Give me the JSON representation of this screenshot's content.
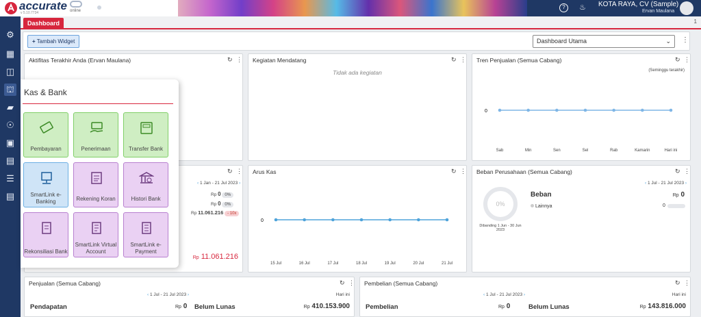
{
  "app": {
    "logo_text": "accurate",
    "logo_sub": "online",
    "version": "v 5.10.7734",
    "company": "KOTA RAYA, CV (Sample)",
    "user": "Ervan Maulana",
    "tab": "Dashboard",
    "tab_count": "1"
  },
  "toolbar": {
    "add_widget": "Tambah Widget",
    "dashboard_select": "Dashboard Utama"
  },
  "panels": {
    "activity": {
      "title": "Aktifitas Terakhir Anda (Ervan Maulana)"
    },
    "upcoming": {
      "title": "Kegiatan Mendatang",
      "empty": "Tidak ada kegiatan"
    },
    "sales_trend": {
      "title": "Tren Penjualan (Semua Cabang)",
      "period": "(Seminggu terakhir)",
      "zero": "0",
      "days": [
        "Sab",
        "Min",
        "Sen",
        "Sel",
        "Rab",
        "Kamarin",
        "Hari ini"
      ]
    },
    "bank": {
      "range": "1 Jan - 21 Jul 2023",
      "v1": "0",
      "v2": "0",
      "v3": "11.061.216",
      "p1": "0%",
      "p2": "0%",
      "p3": "- 10x",
      "total": "11.061.216",
      "rp": "Rp"
    },
    "cashflow": {
      "title": "Arus Kas",
      "zero": "0",
      "days": [
        "15 Jul",
        "16 Jul",
        "17 Jul",
        "18 Jul",
        "19 Jul",
        "20 Jul",
        "21 Jul"
      ]
    },
    "expense": {
      "title": "Beban Perusahaan (Semua Cabang)",
      "range": "1 Jul - 21 Jul 2023",
      "pct": "0%",
      "compare": "Dibanding 1 Jun - 30 Jun 2023",
      "label": "Beban",
      "rp": "Rp",
      "amount": "0",
      "item": "Lainnya",
      "item_value": "0"
    },
    "sales": {
      "title": "Penjualan (Semua Cabang)",
      "range": "1 Jul - 21 Jul 2023",
      "today": "Hari ini",
      "revenue_label": "Pendapatan",
      "revenue": "0",
      "unpaid_label": "Belum Lunas",
      "unpaid": "410.153.900",
      "rp": "Rp"
    },
    "purchase": {
      "title": "Pembelian (Semua Cabang)",
      "range": "1 Jul - 21 Jul 2023",
      "today": "Hari ini",
      "purchase_label": "Pembelian",
      "purchase": "0",
      "unpaid_label": "Belum Lunas",
      "unpaid": "143.816.000",
      "rp": "Rp"
    }
  },
  "menu": {
    "title": "Kas & Bank",
    "items": [
      "Pembayaran",
      "Penerimaan",
      "Transfer Bank",
      "SmartLink e-Banking",
      "Rekening Koran",
      "Histori Bank",
      "Rekonsiliasi Bank",
      "SmartLink Virtual Account",
      "SmartLink e-Payment"
    ]
  },
  "colors": {
    "accent": "#d7263d",
    "primary": "#1f3864",
    "line": "#4ea3da",
    "zero_series": "#7fb6e6"
  },
  "chart_data": [
    {
      "type": "line",
      "title": "Tren Penjualan (Semua Cabang)",
      "categories": [
        "Sab",
        "Min",
        "Sen",
        "Sel",
        "Rab",
        "Kamarin",
        "Hari ini"
      ],
      "values": [
        0,
        0,
        0,
        0,
        0,
        0,
        0
      ]
    },
    {
      "type": "line",
      "title": "Arus Kas",
      "categories": [
        "15 Jul",
        "16 Jul",
        "17 Jul",
        "18 Jul",
        "19 Jul",
        "20 Jul",
        "21 Jul"
      ],
      "values": [
        0,
        0,
        0,
        0,
        0,
        0,
        0
      ]
    }
  ]
}
